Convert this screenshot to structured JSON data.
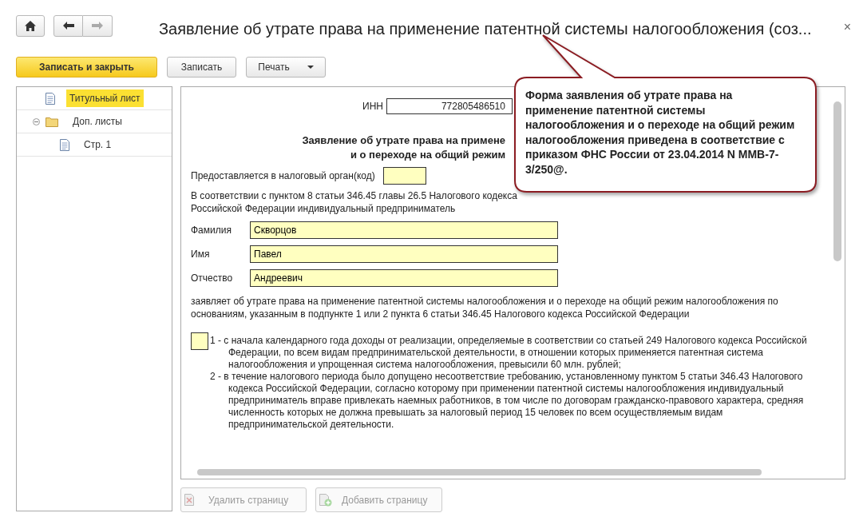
{
  "window": {
    "title": "Заявление об утрате права на применение патентной системы налогообложения (соз...",
    "close": "×"
  },
  "toolbar": {
    "buttons": [
      {
        "label": "Записать и закрыть",
        "kind": "primary"
      },
      {
        "label": "Записать",
        "kind": "plain"
      },
      {
        "label": "Печать",
        "kind": "dropdown"
      }
    ]
  },
  "tree": {
    "items": [
      {
        "label": "Титульный лист",
        "kind": "page",
        "selected": true
      },
      {
        "label": "Доп. листы",
        "kind": "folder",
        "selected": false,
        "expanded": true,
        "children": [
          {
            "label": "Стр. 1",
            "kind": "page",
            "selected": false
          }
        ]
      }
    ]
  },
  "document": {
    "inn_label": "ИНН",
    "inn_value": "772805486510",
    "heading_lines": [
      "Заявление об утрате права на примене",
      "и о переходе на общий режим"
    ],
    "authority_label": "Предоставляется в налоговый орган(код)",
    "intro": "В соответствии с пунктом 8 статьи 346.45 главы 26.5 Налогового кодекса Российской Федерации индивидуальный предприниматель",
    "fields": [
      {
        "label": "Фамилия",
        "value": "Скворцов"
      },
      {
        "label": "Имя",
        "value": "Павел"
      },
      {
        "label": "Отчество",
        "value": "Андреевич"
      }
    ],
    "statement": "заявляет об утрате права на применение патентной системы налогообложения и о переходе на общий режим налогообложения по основаниям, указанным в подпункте 1 или 2 пункта 6 статьи 346.45 Налогового кодекса Российской Федерации",
    "reasons": [
      "1 - с начала календарного года доходы от реализации, определяемые в соответствии со статьей 249 Налогового кодекса Российской Федерации, по всем видам предпринимательской деятельности, в отношении которых применяется патентная система налогообложения и упрощенная система налогообложения, превысили 60 млн. рублей;",
      "2 - в течение налогового периода было допущено несоответствие требованию, установленному пунктом 5 статьи 346.43 Налогового кодекса Российской Федерации, согласно которому при применении патентной системы налогообложения индивидуальный предприниматель вправе привлекать наемных работников, в том числе по договорам гражданско-правового характера, средняя численность которых не должна превышать за налоговый период 15 человек по всем осуществляемым видам предпринимательской деятельности."
    ]
  },
  "page_buttons": [
    {
      "label": "Удалить страницу",
      "kind": "delete",
      "disabled": true
    },
    {
      "label": "Добавить страницу",
      "kind": "add",
      "disabled": true
    }
  ],
  "callout": {
    "text": "Форма заявления об утрате права на применение патентной системы налогообложения и о переходе на общий режим налогообложения приведена в соответствие с приказом ФНС России от 23.04.2014 N ММВ-7-3/250@."
  }
}
